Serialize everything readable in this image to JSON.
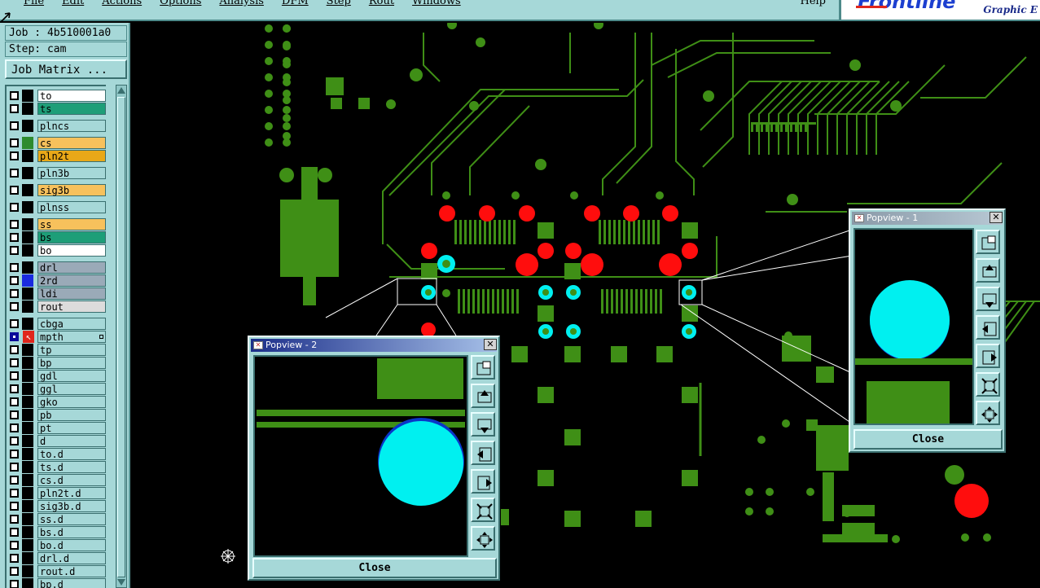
{
  "menubar": {
    "items": [
      {
        "label": "File",
        "name": "menu-file"
      },
      {
        "label": "Edit",
        "name": "menu-edit"
      },
      {
        "label": "Actions",
        "name": "menu-actions"
      },
      {
        "label": "Options",
        "name": "menu-options"
      },
      {
        "label": "Analysis",
        "name": "menu-analysis"
      },
      {
        "label": "DFM",
        "name": "menu-dfm"
      },
      {
        "label": "Step",
        "name": "menu-step"
      },
      {
        "label": "Rout",
        "name": "menu-rout"
      },
      {
        "label": "Windows",
        "name": "menu-windows"
      }
    ],
    "help": "Help"
  },
  "brand": {
    "logo": "Frontline",
    "subtitle": "Graphic E"
  },
  "job": {
    "label": "Job : 4b510001a0",
    "step": "Step: cam"
  },
  "job_matrix_button": "Job Matrix ...",
  "layers": [
    {
      "name": "to",
      "color": "#ffffff",
      "swatch": "#000000"
    },
    {
      "name": "ts",
      "color": "#1e9e78",
      "swatch": "#000000"
    },
    {
      "name": "plncs",
      "color": "#a6d8d8",
      "swatch": "#000000"
    },
    {
      "name": "cs",
      "color": "#f7c15c",
      "swatch": "#2e8b2e"
    },
    {
      "name": "pln2t",
      "color": "#e8a818",
      "swatch": "#000000"
    },
    {
      "name": "pln3b",
      "color": "#a6d8d8",
      "swatch": "#000000"
    },
    {
      "name": "sig3b",
      "color": "#f7c15c",
      "swatch": "#000000"
    },
    {
      "name": "plnss",
      "color": "#a6d8d8",
      "swatch": "#000000"
    },
    {
      "name": "ss",
      "color": "#f7c15c",
      "swatch": "#000000"
    },
    {
      "name": "bs",
      "color": "#1e9e78",
      "swatch": "#000000"
    },
    {
      "name": "bo",
      "color": "#ffffff",
      "swatch": "#000000"
    },
    {
      "name": "drl",
      "color": "#9aaab8",
      "swatch": "#000000"
    },
    {
      "name": "2rd",
      "color": "#9aaab8",
      "swatch": "#1a2ae0"
    },
    {
      "name": "ldi",
      "color": "#9aaab8",
      "swatch": "#000000"
    },
    {
      "name": "rout",
      "color": "#dcdcdc",
      "swatch": "#000000"
    },
    {
      "name": "cbga",
      "color": "#a6d8d8",
      "swatch": "#000000"
    },
    {
      "name": "mpth",
      "color": "#a6d8d8",
      "swatch": "#000000",
      "active": true
    },
    {
      "name": "tp",
      "color": "#a6d8d8",
      "swatch": "#000000"
    },
    {
      "name": "bp",
      "color": "#a6d8d8",
      "swatch": "#000000"
    },
    {
      "name": "gdl",
      "color": "#a6d8d8",
      "swatch": "#000000"
    },
    {
      "name": "ggl",
      "color": "#a6d8d8",
      "swatch": "#000000"
    },
    {
      "name": "gko",
      "color": "#a6d8d8",
      "swatch": "#000000"
    },
    {
      "name": "pb",
      "color": "#a6d8d8",
      "swatch": "#000000"
    },
    {
      "name": "pt",
      "color": "#a6d8d8",
      "swatch": "#000000"
    },
    {
      "name": "d",
      "color": "#a6d8d8",
      "swatch": "#000000"
    },
    {
      "name": "to.d",
      "color": "#a6d8d8",
      "swatch": "#000000"
    },
    {
      "name": "ts.d",
      "color": "#a6d8d8",
      "swatch": "#000000"
    },
    {
      "name": "cs.d",
      "color": "#a6d8d8",
      "swatch": "#000000"
    },
    {
      "name": "pln2t.d",
      "color": "#a6d8d8",
      "swatch": "#000000"
    },
    {
      "name": "sig3b.d",
      "color": "#a6d8d8",
      "swatch": "#000000"
    },
    {
      "name": "ss.d",
      "color": "#a6d8d8",
      "swatch": "#000000"
    },
    {
      "name": "bs.d",
      "color": "#a6d8d8",
      "swatch": "#000000"
    },
    {
      "name": "bo.d",
      "color": "#a6d8d8",
      "swatch": "#000000"
    },
    {
      "name": "drl.d",
      "color": "#a6d8d8",
      "swatch": "#000000"
    },
    {
      "name": "rout.d",
      "color": "#a6d8d8",
      "swatch": "#000000"
    },
    {
      "name": "bp.d",
      "color": "#a6d8d8",
      "swatch": "#000000"
    }
  ],
  "popview1": {
    "title": "Popview - 1",
    "close": "Close"
  },
  "popview2": {
    "title": "Popview - 2",
    "close": "Close"
  },
  "colors": {
    "copper": "#3f8f16",
    "pad_red": "#ff0d0d",
    "pad_cyan": "#00f0f0",
    "panel": "#a6d8d8",
    "titlebar_gradient_start": "#1c2f8a",
    "titlebar_gradient_end": "#a6c0e8"
  },
  "popview_tools": [
    "zoom-window-icon",
    "pan-up-icon",
    "pan-down-icon",
    "pan-left-icon",
    "pan-right-icon",
    "zoom-fit-icon",
    "zoom-home-icon"
  ]
}
